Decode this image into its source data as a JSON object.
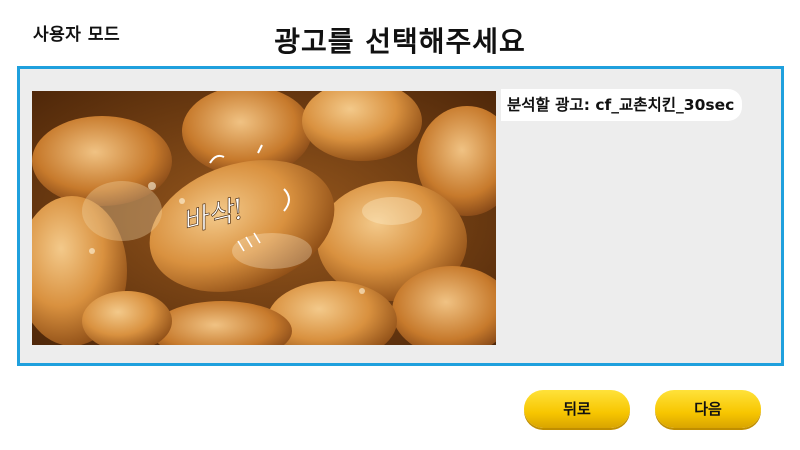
{
  "header": {
    "mode_label": "사용자 모드",
    "title": "광고를 선택해주세요"
  },
  "preview": {
    "image_caption": "바삭!",
    "selected_ad_prefix": "분석할 광고:",
    "selected_ad_name": "cf_교촌치킨_30sec"
  },
  "actions": {
    "back_label": "뒤로",
    "next_label": "다음"
  },
  "colors": {
    "panel_border": "#1fa0dd",
    "panel_bg": "#ededed",
    "button_yellow": "#f7c600"
  }
}
